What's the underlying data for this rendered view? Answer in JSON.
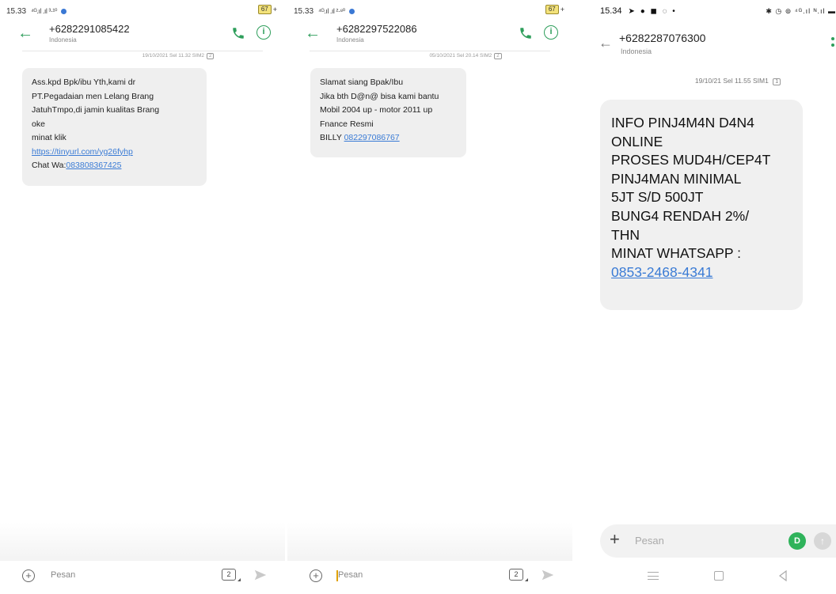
{
  "screens": [
    {
      "status": {
        "time": "15.33",
        "signal": "⁴ᴳ.ıl .ıl ³·¹⁰",
        "battery": "67"
      },
      "header": {
        "contact": "+6282291085422",
        "country": "Indonesia"
      },
      "timestamp": {
        "text": "19/10/2021 Sel 11.32 SIM2",
        "sim": "2"
      },
      "message": {
        "lines": [
          "Ass.kpd Bpk/ibu Yth,kami dr",
          "PT.Pegadaian men Lelang Brang",
          "JatuhTmpo,di jamin kualitas Brang",
          "oke",
          "minat klik"
        ],
        "link": "https://tinyurl.com/yg26fyhp",
        "chat_prefix": "Chat Wa:",
        "chat_number": "083808367425"
      },
      "composer": {
        "placeholder": "Pesan",
        "sim": "2"
      }
    },
    {
      "status": {
        "time": "15.33",
        "signal": "⁴ᴳ.ıl .ıl ²·⁸⁰",
        "battery": "67"
      },
      "header": {
        "contact": "+6282297522086",
        "country": "Indonesia"
      },
      "timestamp": {
        "text": "05/10/2021 Sel 20.14 SIM2",
        "sim": "2"
      },
      "message": {
        "lines": [
          "Slamat siang Bpak/Ibu",
          "Jika bth D@n@ bisa kami bantu",
          "Mobil 2004 up - motor 2011 up",
          "Fnance Resmi"
        ],
        "name_prefix": "BILLY ",
        "phone": "082297086767"
      },
      "composer": {
        "placeholder": "Pesan",
        "sim": "2"
      }
    },
    {
      "status": {
        "time": "15.34",
        "icons": "➤ ● ◼ ◌ •",
        "right": "✱ ◷ ⊚ ⁴ᴳ.ıl ᴺ.ıl ▬"
      },
      "header": {
        "contact": "+6282287076300",
        "country": "Indonesia"
      },
      "timestamp": {
        "text": "19/10/21 Sel 11.55 SIM1",
        "sim": "1"
      },
      "message": {
        "lines": [
          "INFO PINJ4M4N D4N4",
          "ONLINE",
          "PROSES MUD4H/CEP4T",
          "PINJ4MAN MINIMAL",
          "5JT S/D 500JT",
          "BUNG4 RENDAH 2%/",
          "THN",
          "MINAT WHATSAPP :"
        ],
        "phone": "0853-2468-4341"
      },
      "composer": {
        "placeholder": "Pesan",
        "sim_badge": "D"
      }
    }
  ],
  "colors": {
    "accent": "#2e9e5b",
    "link": "#3a7bd5",
    "bubble": "#efefef",
    "sim_green": "#2fb35b"
  },
  "icons": [
    "back-arrow-icon",
    "phone-icon",
    "info-icon",
    "add-icon",
    "sim-card-icon",
    "send-icon",
    "menu-icon",
    "home-icon",
    "nav-back-icon"
  ]
}
